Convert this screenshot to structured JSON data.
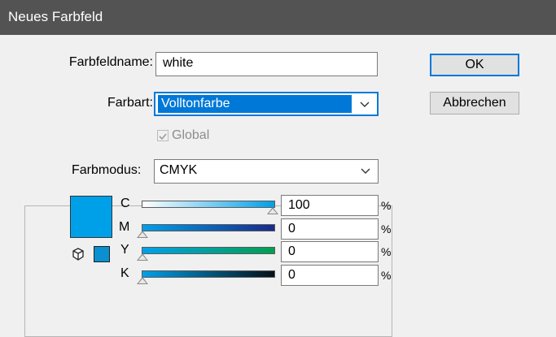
{
  "dialog": {
    "title": "Neues Farbfeld"
  },
  "form": {
    "name_label": "Farbfeldname:",
    "name_value": "white",
    "type_label": "Farbart:",
    "type_value": "Volltonfarbe",
    "global_label": "Global",
    "global_checked": true,
    "mode_label": "Farbmodus:",
    "mode_value": "CMYK"
  },
  "buttons": {
    "ok": "OK",
    "cancel": "Abbrechen"
  },
  "swatch_color": "#00a0e9",
  "channels": [
    {
      "label": "C",
      "value": "100",
      "unit": "%"
    },
    {
      "label": "M",
      "value": "0",
      "unit": "%"
    },
    {
      "label": "Y",
      "value": "0",
      "unit": "%"
    },
    {
      "label": "K",
      "value": "0",
      "unit": "%"
    }
  ],
  "icons": {
    "chevron": "chevron-down-icon",
    "cube": "cube-icon",
    "check": "checkmark-icon"
  }
}
